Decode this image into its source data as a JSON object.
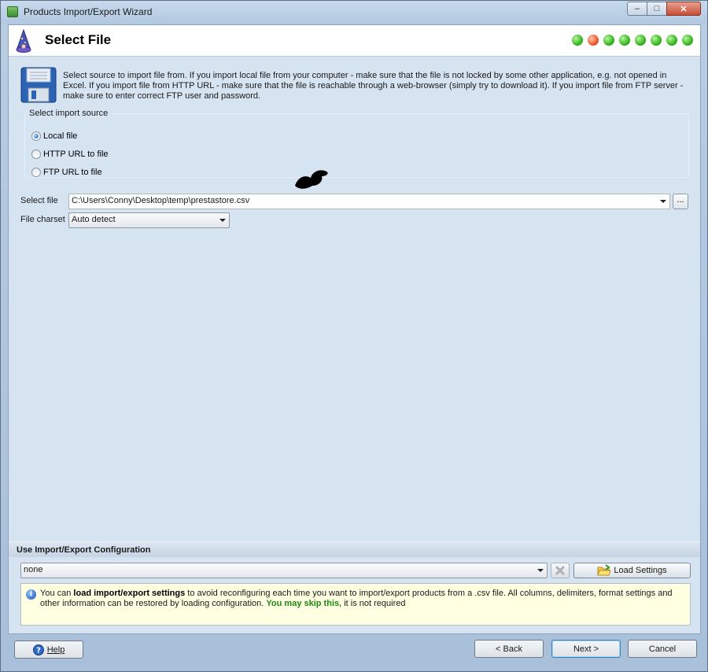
{
  "window": {
    "title": "Products Import/Export Wizard",
    "controls": {
      "minimize": "–",
      "maximize": "□",
      "close": "✕"
    }
  },
  "header": {
    "title": "Select File",
    "steps_total": 8,
    "current_step": 2,
    "step_colors": {
      "done": "#36b71f",
      "current": "#ef5a2e"
    }
  },
  "info": {
    "icon": "floppy-disk-icon",
    "text": "Select source to import file from. If you import local file from your computer - make sure that the file is not locked by some other application, e.g. not opened in Excel. If you import file from HTTP URL - make sure that the file is reachable through a web-browser (simply try to download it). If you import file from FTP server - make sure to enter correct FTP user and password."
  },
  "import_source": {
    "legend": "Select import source",
    "options": [
      {
        "label": "Local file",
        "checked": true
      },
      {
        "label": "HTTP URL to file",
        "checked": false
      },
      {
        "label": "FTP URL to file",
        "checked": false
      }
    ]
  },
  "select_file": {
    "label": "Select file",
    "value": "C:\\Users\\Conny\\Desktop\\temp\\prestastore.csv",
    "browse_label": "..."
  },
  "file_charset": {
    "label": "File charset",
    "value": "Auto detect"
  },
  "configuration": {
    "section_label": "Use Import/Export Configuration",
    "value": "none",
    "load_label": "Load Settings",
    "hint_parts": [
      "You can ",
      "load import/export settings",
      " to avoid reconfiguring each time you want to import/export products from a .csv file. All columns, delimiters, format settings and other information can be restored by loading configuration. ",
      "You may skip this",
      ", it is not required"
    ]
  },
  "footer": {
    "help_label": "Help",
    "back_label": "< Back",
    "next_label": "Next >",
    "cancel_label": "Cancel"
  }
}
